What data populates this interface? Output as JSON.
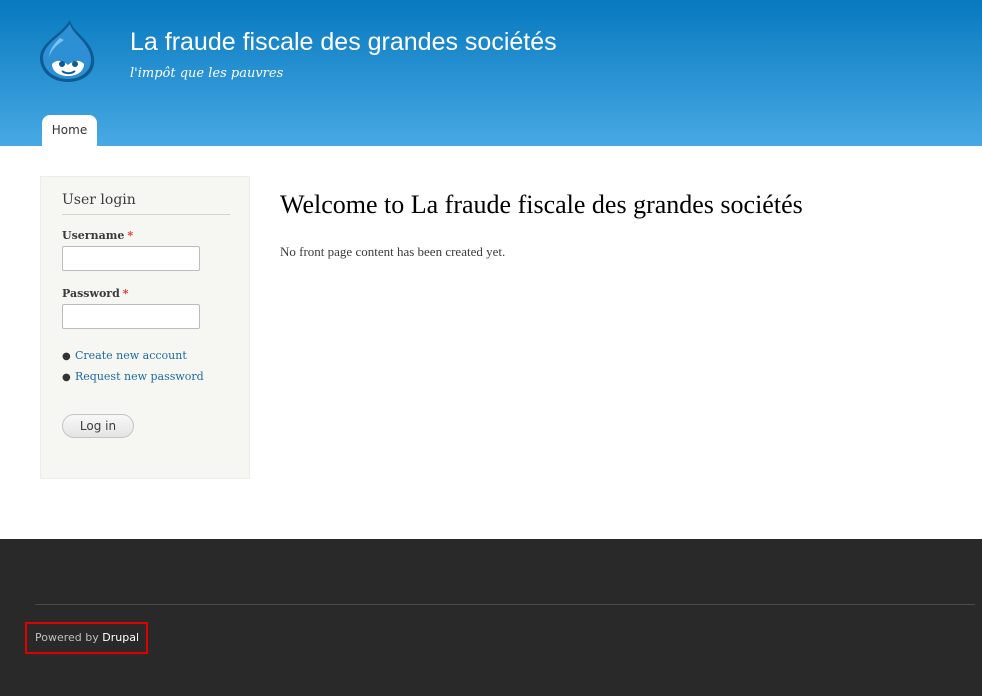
{
  "header": {
    "site_name": "La fraude fiscale des grandes sociétés",
    "site_slogan": "l'impôt que les pauvres",
    "logo_icon": "drupal-drop-icon",
    "nav": [
      {
        "label": "Home",
        "active": true
      }
    ]
  },
  "sidebar": {
    "block_title": "User login",
    "username_label": "Username",
    "password_label": "Password",
    "required_marker": "*",
    "username_value": "",
    "password_value": "",
    "links": [
      {
        "label": "Create new account"
      },
      {
        "label": "Request new password"
      }
    ],
    "login_button": "Log in"
  },
  "main": {
    "title": "Welcome to La fraude fiscale des grandes sociétés",
    "body": "No front page content has been created yet."
  },
  "footer": {
    "powered_prefix": "Powered by",
    "powered_link": "Drupal"
  },
  "colors": {
    "header_top": "#0779bf",
    "header_bottom": "#48a9e4",
    "link": "#1f6b9e",
    "footer_bg": "#292929",
    "highlight_box": "#e00000"
  }
}
